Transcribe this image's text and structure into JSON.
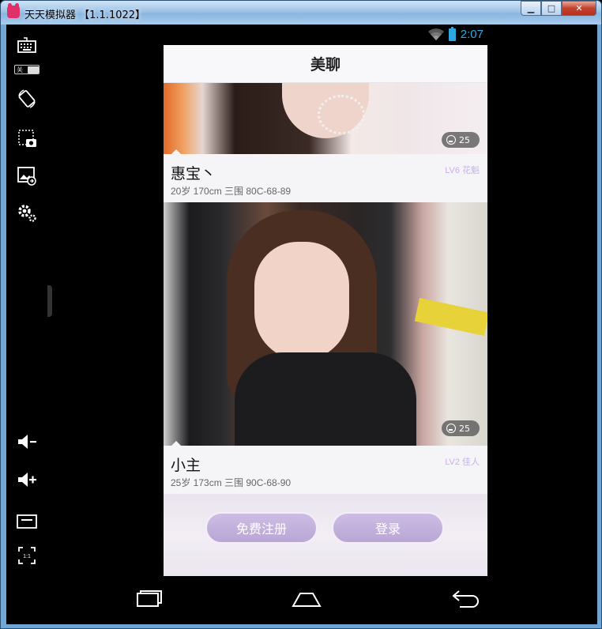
{
  "window": {
    "title": "天天模拟器 【1.1.1022】",
    "buttons": {
      "minimize": "▁",
      "maximize": "□",
      "close": "✕"
    }
  },
  "toolbar": {
    "items": [
      {
        "icon": "keyboard-icon"
      },
      {
        "icon": "rotate-icon"
      },
      {
        "icon": "screenshot-icon"
      },
      {
        "icon": "image-share-icon"
      },
      {
        "icon": "settings-icon"
      },
      {
        "icon": "volume-down-icon"
      },
      {
        "icon": "volume-up-icon"
      },
      {
        "icon": "menu-icon"
      },
      {
        "icon": "fullscreen-icon"
      }
    ],
    "keyboard_toggle_label": "关",
    "fullscreen_label": "1:1"
  },
  "status_bar": {
    "time": "2:07",
    "icons": [
      "wifi-icon",
      "battery-icon"
    ]
  },
  "app": {
    "title": "美聊",
    "profiles": [
      {
        "name": "惠宝丶",
        "details": "20岁  170cm  三围 80C-68-89",
        "level": "LV6 花魁",
        "photo_count": "25"
      },
      {
        "name": "小主",
        "details": "25岁  173cm  三围 90C-68-90",
        "level": "LV2 佳人",
        "photo_count": "25"
      }
    ],
    "register_label": "免费注册",
    "login_label": "登录"
  },
  "nav_bar": {
    "icons": [
      "recent-apps-icon",
      "home-icon",
      "back-icon"
    ]
  },
  "colors": {
    "clock": "#2fa7e0",
    "level_text": "#c8aef0",
    "button": "#b9a6d6"
  }
}
